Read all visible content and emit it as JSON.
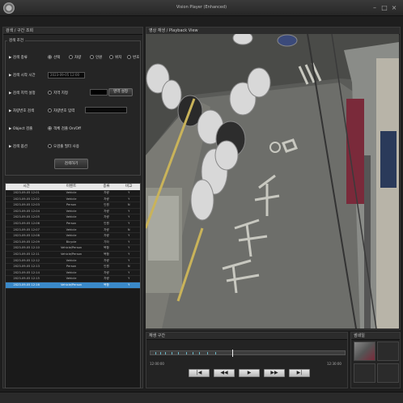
{
  "window": {
    "title": "Vision Player (Enhanced)"
  },
  "left": {
    "header": "검색 / 구간 조회",
    "group_title": "검색 조건",
    "search_type": {
      "label": "검색 종류",
      "options": [
        "선택",
        "차량",
        "인원",
        "위치",
        "번호"
      ],
      "selected": 0
    },
    "time": {
      "label": "검색 시작 시간",
      "value": "2023-09-05 12:00"
    },
    "region": {
      "label": "검색 지역 설정",
      "checkbox_label": "지역 지정",
      "button": "영역 설정"
    },
    "plate": {
      "label": "차량번호 검색",
      "checkbox_label": "차량번호 입력"
    },
    "object": {
      "label": "Object 검출",
      "checkbox_label": "객체 검출 On/Off"
    },
    "filter": {
      "label": "검색 옵션",
      "checkbox_label": "오검출 필터 사용"
    },
    "search_button": "검색하기",
    "columns": [
      "시간",
      "이벤트",
      "종류",
      "비고"
    ],
    "rows": [
      [
        "2023-09-05 12:01",
        "Vehicle",
        "차량",
        "Y"
      ],
      [
        "2023-09-05 12:02",
        "Vehicle",
        "차량",
        "Y"
      ],
      [
        "2023-09-05 12:03",
        "Person",
        "인원",
        "N"
      ],
      [
        "2023-09-05 12:04",
        "Vehicle",
        "차량",
        "Y"
      ],
      [
        "2023-09-05 12:05",
        "Vehicle",
        "차량",
        "Y"
      ],
      [
        "2023-09-05 12:06",
        "Person",
        "인원",
        "Y"
      ],
      [
        "2023-09-05 12:07",
        "Vehicle",
        "차량",
        "N"
      ],
      [
        "2023-09-05 12:08",
        "Vehicle",
        "차량",
        "Y"
      ],
      [
        "2023-09-05 12:09",
        "Bicycle",
        "기타",
        "Y"
      ],
      [
        "2023-09-05 12:10",
        "Vehicle/Person",
        "복합",
        "Y"
      ],
      [
        "2023-09-05 12:11",
        "Vehicle/Person",
        "복합",
        "Y"
      ],
      [
        "2023-09-05 12:12",
        "Vehicle",
        "차량",
        "Y"
      ],
      [
        "2023-09-05 12:13",
        "Person",
        "인원",
        "N"
      ],
      [
        "2023-09-05 12:14",
        "Vehicle",
        "차량",
        "Y"
      ],
      [
        "2023-09-05 12:15",
        "Vehicle",
        "차량",
        "Y"
      ],
      [
        "2023-09-05 12:16",
        "Vehicle/Person",
        "복합",
        "Y"
      ]
    ],
    "selected_row": 15
  },
  "video": {
    "header": "영상 재생 / Playback View"
  },
  "timeline": {
    "header": "재생 구간",
    "time_start": "12:00:00",
    "time_end": "12:30:00",
    "progress": 0.42,
    "buttons": [
      "|◀",
      "◀◀",
      "▶",
      "▶▶",
      "▶|"
    ]
  },
  "thumbs": {
    "header": "썸네일"
  },
  "colors": {
    "accent": "#3a89c9",
    "tick": "#6ab8c8"
  }
}
